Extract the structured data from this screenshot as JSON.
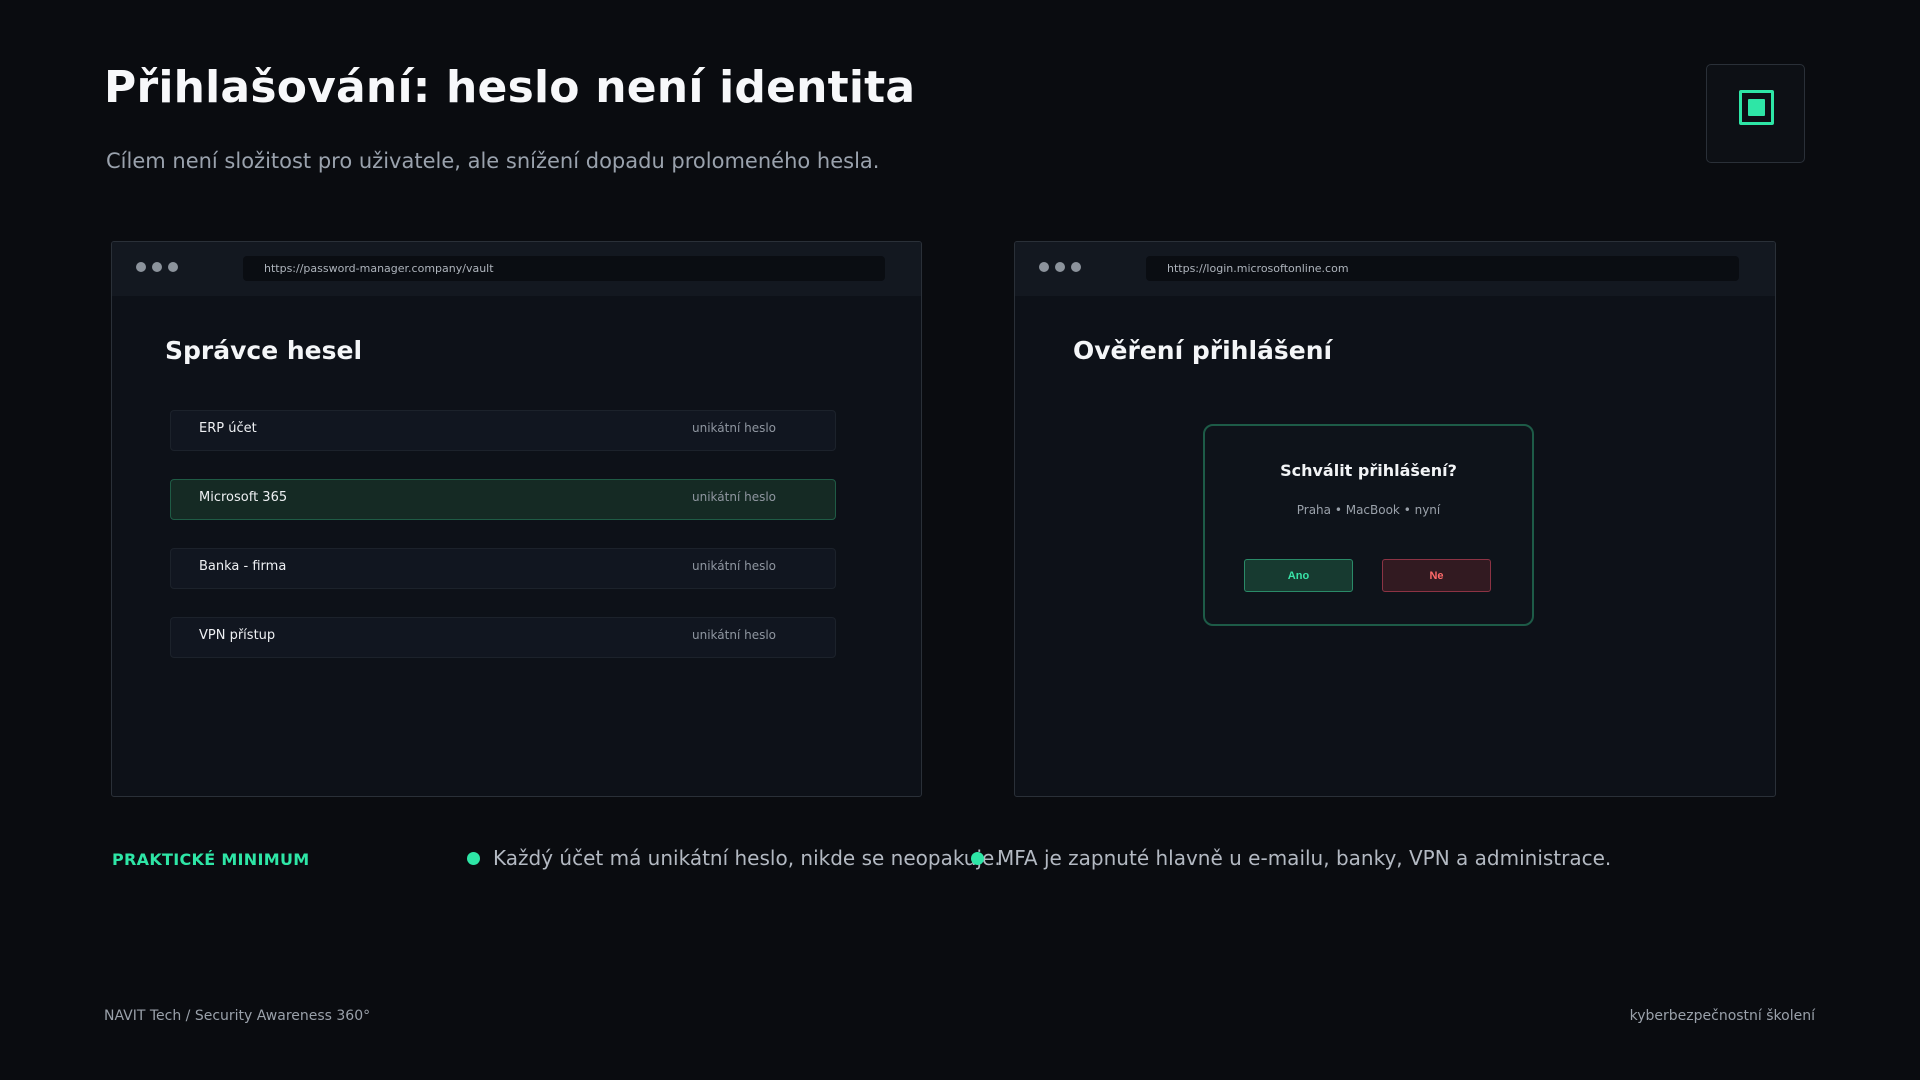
{
  "header": {
    "title": "Přihlašování: heslo není identita",
    "subtitle": "Cílem není složitost pro uživatele, ale snížení dopadu prolomeného hesla."
  },
  "logo": {
    "icon": "square-logo-icon",
    "accent": "#2ee6a6"
  },
  "password_manager": {
    "url": "https://password-manager.company/vault",
    "title": "Správce hesel",
    "items": [
      {
        "name": "ERP účet",
        "tag": "unikátní heslo",
        "highlighted": false
      },
      {
        "name": "Microsoft 365",
        "tag": "unikátní heslo",
        "highlighted": true
      },
      {
        "name": "Banka - firma",
        "tag": "unikátní heslo",
        "highlighted": false
      },
      {
        "name": "VPN přístup",
        "tag": "unikátní heslo",
        "highlighted": false
      }
    ]
  },
  "login_verification": {
    "url": "https://login.microsoftonline.com",
    "title": "Ověření přihlášení",
    "prompt": {
      "question": "Schválit přihlášení?",
      "meta": "Praha • MacBook • nyní",
      "approve_label": "Ano",
      "deny_label": "Ne"
    }
  },
  "practical_minimum": {
    "label": "PRAKTICKÉ MINIMUM",
    "points": [
      "Každý účet má unikátní heslo, nikde se neopakuje.",
      "MFA je zapnuté hlavně u e-mailu, banky, VPN a administrace."
    ]
  },
  "footer": {
    "left": "NAVIT Tech / Security Awareness 360°",
    "right": "kyberbezpečnostní školení"
  },
  "colors": {
    "background": "#0a0c10",
    "accent": "#2ee6a6",
    "deny": "#ff6a6a"
  }
}
